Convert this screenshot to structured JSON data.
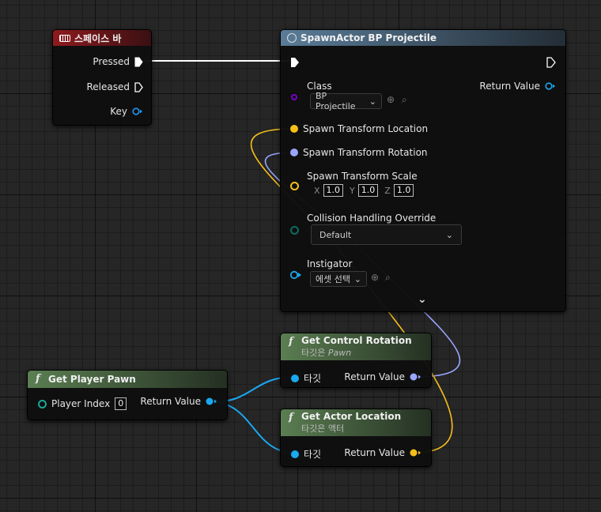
{
  "colors": {
    "exec": "#ffffff",
    "key_pin": "#1e9af7",
    "class_pin": "#7a00c8",
    "vector_pin": "#f5bf1a",
    "rotator_pin": "#9aa6ff",
    "object_pin": "#1ba8f0",
    "enum_pin": "#0c6b60",
    "struct_pin": "#1aa898"
  },
  "spacebar_node": {
    "title": "스페이스 바",
    "icon": "keyboard-icon",
    "pressed": "Pressed",
    "released": "Released",
    "key": "Key"
  },
  "spawn_node": {
    "title": "SpawnActor BP Projectile",
    "icon": "spawn-icon",
    "class_label": "Class",
    "class_value": "BP Projectile",
    "return_value": "Return Value",
    "location": "Spawn Transform Location",
    "rotation": "Spawn Transform Rotation",
    "scale": "Spawn Transform Scale",
    "scale_x_label": "X",
    "scale_x": "1.0",
    "scale_y_label": "Y",
    "scale_y": "1.0",
    "scale_z_label": "Z",
    "scale_z": "1.0",
    "collision_label": "Collision Handling Override",
    "collision_value": "Default",
    "instigator_label": "Instigator",
    "instigator_value": "에셋 선택"
  },
  "player_pawn_node": {
    "title": "Get Player Pawn",
    "player_index_label": "Player Index",
    "player_index_value": "0",
    "return_value": "Return Value"
  },
  "control_rotation_node": {
    "title": "Get Control Rotation",
    "subtitle_prefix": "타깃은 ",
    "subtitle_target": "Pawn",
    "target": "타깃",
    "return_value": "Return Value"
  },
  "actor_location_node": {
    "title": "Get Actor Location",
    "subtitle": "타깃은 액터",
    "target": "타깃",
    "return_value": "Return Value"
  }
}
